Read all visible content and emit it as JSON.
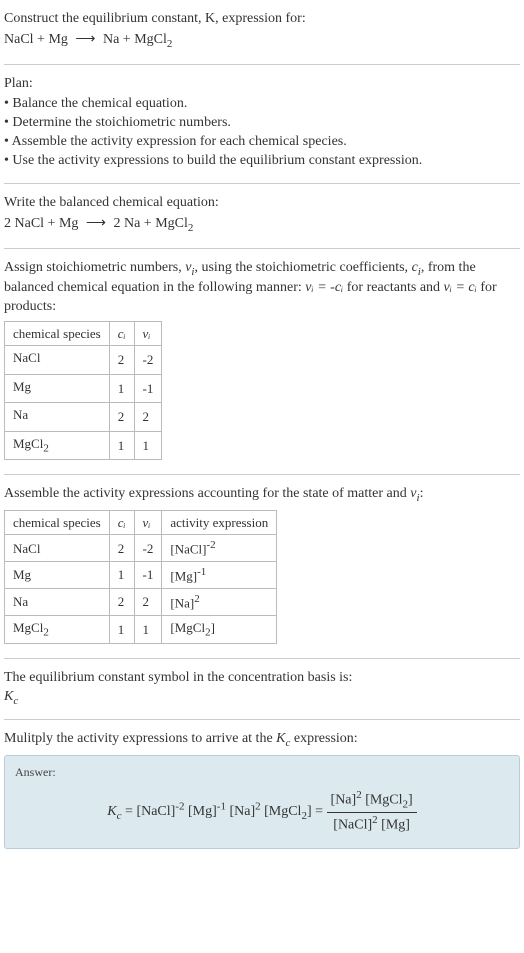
{
  "header": {
    "prompt": "Construct the equilibrium constant, K, expression for:",
    "reaction_lhs": "NaCl + Mg",
    "arrow": "⟶",
    "reaction_rhs": "Na + MgCl",
    "reaction_rhs_sub": "2"
  },
  "plan": {
    "title": "Plan:",
    "items": [
      "Balance the chemical equation.",
      "Determine the stoichiometric numbers.",
      "Assemble the activity expression for each chemical species.",
      "Use the activity expressions to build the equilibrium constant expression."
    ]
  },
  "balanced": {
    "title": "Write the balanced chemical equation:",
    "lhs": "2 NaCl + Mg",
    "arrow": "⟶",
    "rhs": "2 Na + MgCl",
    "rhs_sub": "2"
  },
  "stoich": {
    "intro1": "Assign stoichiometric numbers, ",
    "nu": "ν",
    "sub_i": "i",
    "intro2": ", using the stoichiometric coefficients, ",
    "c": "c",
    "intro3": ", from the balanced chemical equation in the following manner: ",
    "nu_eq_neg_c": "νᵢ = -cᵢ",
    "for_reactants": " for reactants and ",
    "nu_eq_c": "νᵢ = cᵢ",
    "for_products": " for products:",
    "table": {
      "headers": [
        "chemical species",
        "cᵢ",
        "νᵢ"
      ],
      "rows": [
        {
          "species": "NaCl",
          "sub": "",
          "c": "2",
          "nu": "-2"
        },
        {
          "species": "Mg",
          "sub": "",
          "c": "1",
          "nu": "-1"
        },
        {
          "species": "Na",
          "sub": "",
          "c": "2",
          "nu": "2"
        },
        {
          "species": "MgCl",
          "sub": "2",
          "c": "1",
          "nu": "1"
        }
      ]
    }
  },
  "activity": {
    "intro1": "Assemble the activity expressions accounting for the state of matter and ",
    "nu": "ν",
    "sub_i": "i",
    "intro2": ":",
    "table": {
      "headers": [
        "chemical species",
        "cᵢ",
        "νᵢ",
        "activity expression"
      ],
      "rows": [
        {
          "species": "NaCl",
          "sub": "",
          "c": "2",
          "nu": "-2",
          "expr_base": "[NaCl]",
          "expr_sup": "-2",
          "expr_sub": ""
        },
        {
          "species": "Mg",
          "sub": "",
          "c": "1",
          "nu": "-1",
          "expr_base": "[Mg]",
          "expr_sup": "-1",
          "expr_sub": ""
        },
        {
          "species": "Na",
          "sub": "",
          "c": "2",
          "nu": "2",
          "expr_base": "[Na]",
          "expr_sup": "2",
          "expr_sub": ""
        },
        {
          "species": "MgCl",
          "sub": "2",
          "c": "1",
          "nu": "1",
          "expr_base": "[MgCl",
          "expr_sup": "",
          "expr_sub": "2",
          "expr_close": "]"
        }
      ]
    }
  },
  "basis": {
    "line": "The equilibrium constant symbol in the concentration basis is:",
    "symbol": "K",
    "sub": "c"
  },
  "multiply": {
    "line1": "Mulitply the activity expressions to arrive at the ",
    "kc": "K",
    "kc_sub": "c",
    "line2": " expression:"
  },
  "answer": {
    "label": "Answer:",
    "kc": "K",
    "kc_sub": "c",
    "eq": " = ",
    "flat": {
      "t1": "[NaCl]",
      "t1sup": "-2",
      "t2": " [Mg]",
      "t2sup": "-1",
      "t3": " [Na]",
      "t3sup": "2",
      "t4": " [MgCl",
      "t4sub": "2",
      "t4close": "]"
    },
    "eq2": " = ",
    "frac": {
      "num1": "[Na]",
      "num1sup": "2",
      "num2": " [MgCl",
      "num2sub": "2",
      "num2close": "]",
      "den1": "[NaCl]",
      "den1sup": "2",
      "den2": " [Mg]"
    }
  }
}
